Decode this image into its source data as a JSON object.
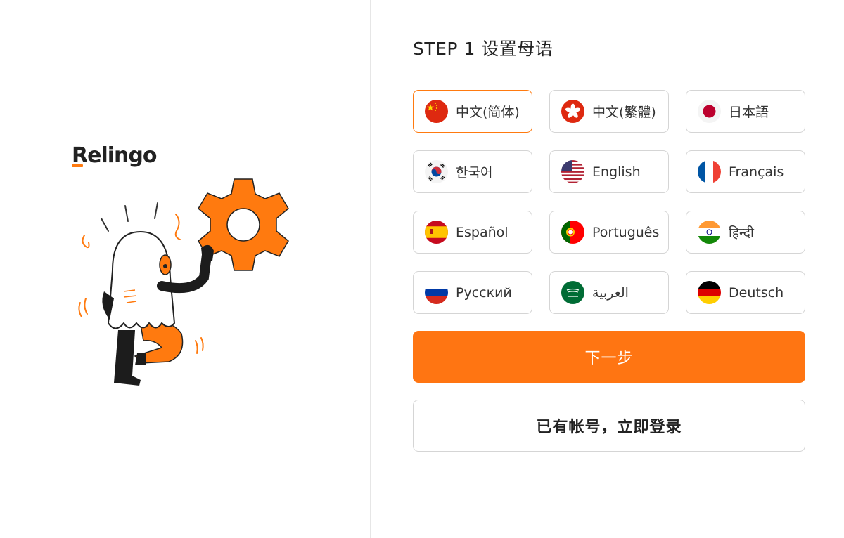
{
  "brand": {
    "logo_text": "Relingo",
    "accent_color": "#ff7512"
  },
  "step": {
    "title": "STEP 1 设置母语"
  },
  "languages": [
    {
      "label": "中文(简体)",
      "flag": "cn-flag-icon",
      "selected": true
    },
    {
      "label": "中文(繁體)",
      "flag": "hk-flag-icon",
      "selected": false
    },
    {
      "label": "日本語",
      "flag": "jp-flag-icon",
      "selected": false
    },
    {
      "label": "한국어",
      "flag": "kr-flag-icon",
      "selected": false
    },
    {
      "label": "English",
      "flag": "us-flag-icon",
      "selected": false
    },
    {
      "label": "Français",
      "flag": "fr-flag-icon",
      "selected": false
    },
    {
      "label": "Español",
      "flag": "es-flag-icon",
      "selected": false
    },
    {
      "label": "Português",
      "flag": "pt-flag-icon",
      "selected": false
    },
    {
      "label": "हिन्दी",
      "flag": "in-flag-icon",
      "selected": false
    },
    {
      "label": "Русский",
      "flag": "ru-flag-icon",
      "selected": false
    },
    {
      "label": "العربية",
      "flag": "sa-flag-icon",
      "selected": false
    },
    {
      "label": "Deutsch",
      "flag": "de-flag-icon",
      "selected": false
    }
  ],
  "buttons": {
    "next_label": "下一步",
    "login_label": "已有帐号，立即登录"
  }
}
